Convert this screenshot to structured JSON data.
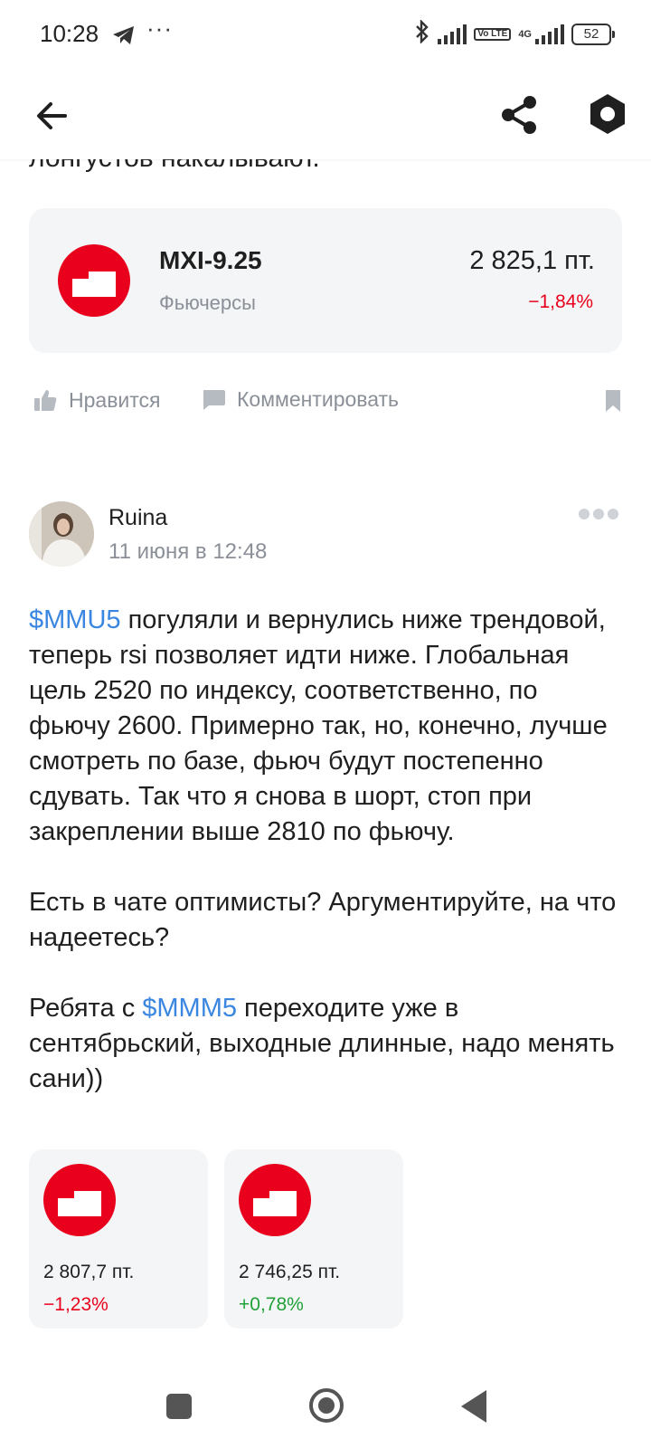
{
  "status_bar": {
    "time": "10:28",
    "dots": "···",
    "volte": "Vo LTE",
    "network": "4G",
    "battery": "52"
  },
  "header": {
    "back_icon": "arrow-left-icon",
    "share_icon": "share-icon",
    "settings_icon": "gear-icon"
  },
  "prev_post": {
    "cutoff_text": "лонгустов накалывают."
  },
  "instrument": {
    "ticker": "MXI-9.25",
    "type": "Фьючерсы",
    "price": "2 825,1  пт.",
    "change": "−1,84%"
  },
  "actions": {
    "like_label": "Нравится",
    "comment_label": "Комментировать"
  },
  "post": {
    "author": "Ruina",
    "date": "11 июня в 12:48",
    "p1_ticker": "$MMU5",
    "p1_text": " погуляли и вернулись ниже трендовой, теперь rsi позволяет идти ниже. Глобальная цель 2520 по индексу, соответственно, по фьючу 2600. Примерно так, но, конечно, лучше смотреть по базе, фьюч будут постепенно сдувать. Так что я снова в шорт, стоп при закреплении выше 2810 по фьючу.",
    "p2_text": "Есть в чате оптимисты? Аргументируйте, на что надеетесь?",
    "p3_pre": "Ребята с ",
    "p3_ticker": "$MMM5",
    "p3_text": " переходите уже в сентябрьский, выходные длинные, надо менять сани))"
  },
  "mini_cards": [
    {
      "price": "2 807,7   пт.",
      "change": "−1,23%",
      "trend": "neg"
    },
    {
      "price": "2 746,25   пт.",
      "change": "+0,78%",
      "trend": "pos"
    }
  ],
  "colors": {
    "accent_red": "#e8001c",
    "link_blue": "#3a86e0",
    "positive_green": "#21a038",
    "muted_gray": "#8a8f98"
  }
}
